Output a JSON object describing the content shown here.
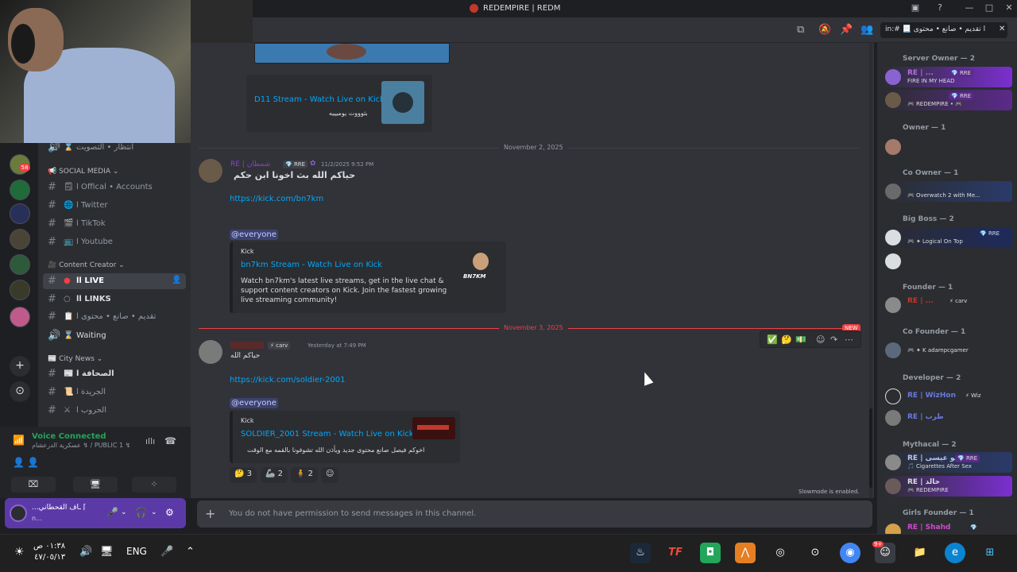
{
  "window": {
    "title": "REDEMPIRE | REDM"
  },
  "search": {
    "value": "in:# 📃 ا تقديم • صانع • محتوى"
  },
  "rail": {
    "badges": [
      "99",
      "58"
    ]
  },
  "sidebar": {
    "top_channel": "انتظار • التصويت",
    "categories": [
      "SOCIAL MEDIA",
      "Content Creator",
      "City News"
    ],
    "social": [
      "ا Offical • Accounts",
      "ا Twitter",
      "ا TikTok",
      "ا Youtube"
    ],
    "creator": [
      "اا LIVE",
      "اا LINKS",
      "تقديم • صانع • محتوى ا",
      "Waiting"
    ],
    "news": [
      "الصحافة ا",
      "الجريدة ا",
      "الحروب ا"
    ]
  },
  "voice": {
    "status": "Voice Connected",
    "channel": "عسكرية الدرعشام ↯ / PUBLIC 1 ↯"
  },
  "user": {
    "name": "...ـاف القحطاني ⌈",
    "status": "n..."
  },
  "messages": {
    "embed0": {
      "title": "D11 Stream - Watch Live on Kick",
      "desc": "بثوووت يوميييه"
    },
    "date1": "November 2, 2025",
    "msg1": {
      "author": "RE | شمطان",
      "tag": "💎 RRE",
      "time": "11/2/2025 9:52 PM",
      "text": "حياكم الله بث اخونا ابن حكم",
      "link": "https://kick.com/bn7km",
      "mention": "@everyone",
      "embed": {
        "provider": "Kick",
        "title": "bn7km Stream - Watch Live on Kick",
        "desc": "Watch bn7km's latest live streams, get in the live chat & support content creators on Kick. Join the fastest growing live streaming community!",
        "thumb": "BN7KM"
      }
    },
    "date2": "November 3, 2025",
    "new_badge": "NEW",
    "msg2": {
      "tag": "⚡ carv",
      "time": "Yesterday at 7:49 PM",
      "text": "حياكم الله",
      "link": "https://kick.com/soldier-2001",
      "mention": "@everyone",
      "embed": {
        "provider": "Kick",
        "title": "SOLDIER_2001 Stream - Watch Live on Kick",
        "desc": "اخوكم فيصل صانع محتوى جديد ويأذن الله تشوفونا بالقمه مع الوقت"
      },
      "reactions": [
        {
          "emoji": "🤔",
          "count": "3"
        },
        {
          "emoji": "🦾",
          "count": "2"
        },
        {
          "emoji": "🧍",
          "count": "2"
        }
      ]
    }
  },
  "composer": {
    "placeholder": "You do not have permission to send messages in this channel.",
    "slowmode": "Slowmode is enabled."
  },
  "members": {
    "roles": [
      "Server Owner — 2",
      "Owner — 1",
      "Co Owner — 1",
      "Big Boss — 2",
      "Founder — 1",
      "Co Founder — 1",
      "Developer — 2",
      "Mythacal — 2",
      "Girls Founder — 1"
    ],
    "list": [
      {
        "name": "RE | ...",
        "tag": "💎 RRE",
        "status": "FIRE IN MY HEAD"
      },
      {
        "name": "",
        "tag": "💎 RRE",
        "status": "🎮 REDEMPIRE • 🎮"
      },
      {
        "name": "",
        "tag": "",
        "status": ""
      },
      {
        "name": "",
        "tag": "",
        "status": "🎮 Overwatch 2 with Me..."
      },
      {
        "name": "",
        "tag": "💎 RRE",
        "status": "🎮 ✦ Logical On Top"
      },
      {
        "name": "",
        "tag": "",
        "status": ""
      },
      {
        "name": "RE | ...",
        "tag": "⚡ carv",
        "status": ""
      },
      {
        "name": "",
        "tag": "",
        "status": "🎮 ✦ K adampcgamer"
      },
      {
        "name": "RE | WizHon",
        "tag": "⚡ Wiz",
        "status": ""
      },
      {
        "name": "RE | طرب",
        "tag": "",
        "status": ""
      },
      {
        "name": "RE | ابو عيسى",
        "tag": "💎 RRE",
        "status": "🎵 Cigarettes After Sex"
      },
      {
        "name": "RE | خالد",
        "tag": "",
        "status": "🎮 REDEMPIRE"
      },
      {
        "name": "RE | Shahd",
        "tag": "💎",
        "status": ""
      }
    ]
  },
  "taskbar": {
    "time": "٠١:٣٨ ص",
    "date": "٤٧/٠٥/١٣",
    "lang": "ENG",
    "discord_badge": "9+"
  }
}
